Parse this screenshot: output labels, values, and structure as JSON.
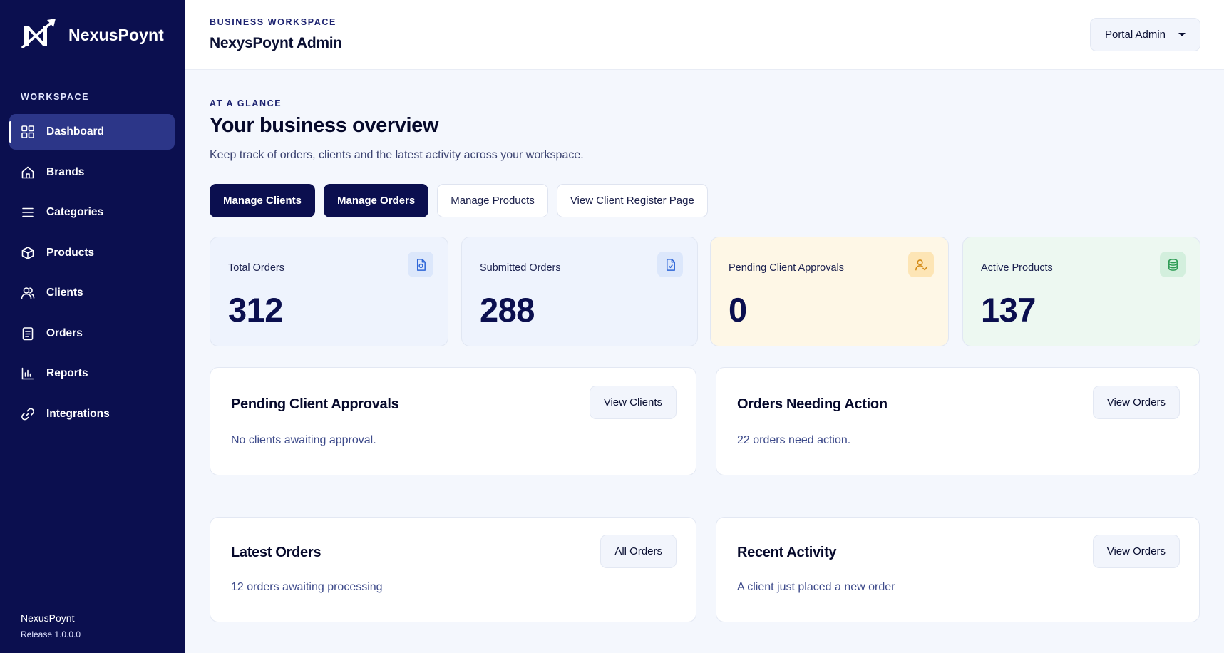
{
  "sidebar": {
    "brand": "NexusPoynt",
    "section_label": "WORKSPACE",
    "items": [
      {
        "label": "Dashboard",
        "icon": "grid-icon",
        "active": true
      },
      {
        "label": "Brands",
        "icon": "home-icon",
        "active": false
      },
      {
        "label": "Categories",
        "icon": "list-icon",
        "active": false
      },
      {
        "label": "Products",
        "icon": "box-icon",
        "active": false
      },
      {
        "label": "Clients",
        "icon": "users-icon",
        "active": false
      },
      {
        "label": "Orders",
        "icon": "clipboard-icon",
        "active": false
      },
      {
        "label": "Reports",
        "icon": "bar-chart-icon",
        "active": false
      },
      {
        "label": "Integrations",
        "icon": "link-icon",
        "active": false
      }
    ],
    "footer": {
      "brand": "NexusPoynt",
      "release": "Release 1.0.0.0"
    }
  },
  "header": {
    "eyebrow": "BUSINESS WORKSPACE",
    "title": "NexysPoynt Admin",
    "user_menu": "Portal Admin"
  },
  "main": {
    "eyebrow": "AT A GLANCE",
    "title": "Your business overview",
    "subtitle": "Keep track of orders, clients and the latest activity across your workspace.",
    "actions": [
      {
        "label": "Manage Clients",
        "style": "primary"
      },
      {
        "label": "Manage Orders",
        "style": "primary"
      },
      {
        "label": "Manage Products",
        "style": "secondary"
      },
      {
        "label": "View Client Register Page",
        "style": "secondary"
      }
    ],
    "stats": [
      {
        "label": "Total Orders",
        "value": "312",
        "icon": "file-icon",
        "bg": "#eef3fd",
        "icon_bg": "#dce7fb",
        "icon_color": "#2f67d8"
      },
      {
        "label": "Submitted Orders",
        "value": "288",
        "icon": "document-icon",
        "bg": "#eef3fd",
        "icon_bg": "#dce7fb",
        "icon_color": "#2f67d8"
      },
      {
        "label": "Pending Client Approvals",
        "value": "0",
        "icon": "user-check-icon",
        "bg": "#fef7e6",
        "icon_bg": "#fde5b5",
        "icon_color": "#d48a14"
      },
      {
        "label": "Active Products",
        "value": "137",
        "icon": "database-icon",
        "bg": "#edf8f1",
        "icon_bg": "#d3efdd",
        "icon_color": "#2b9a52"
      }
    ],
    "cards": [
      {
        "title": "Pending Client Approvals",
        "text": "No clients awaiting approval.",
        "button": "View Clients"
      },
      {
        "title": "Orders Needing Action",
        "text": "22 orders need action.",
        "button": "View Orders"
      },
      {
        "title": "Latest Orders",
        "text": "12 orders awaiting processing",
        "button": "All Orders"
      },
      {
        "title": "Recent Activity",
        "text": "A client just placed a new order",
        "button": "View Orders"
      }
    ]
  }
}
